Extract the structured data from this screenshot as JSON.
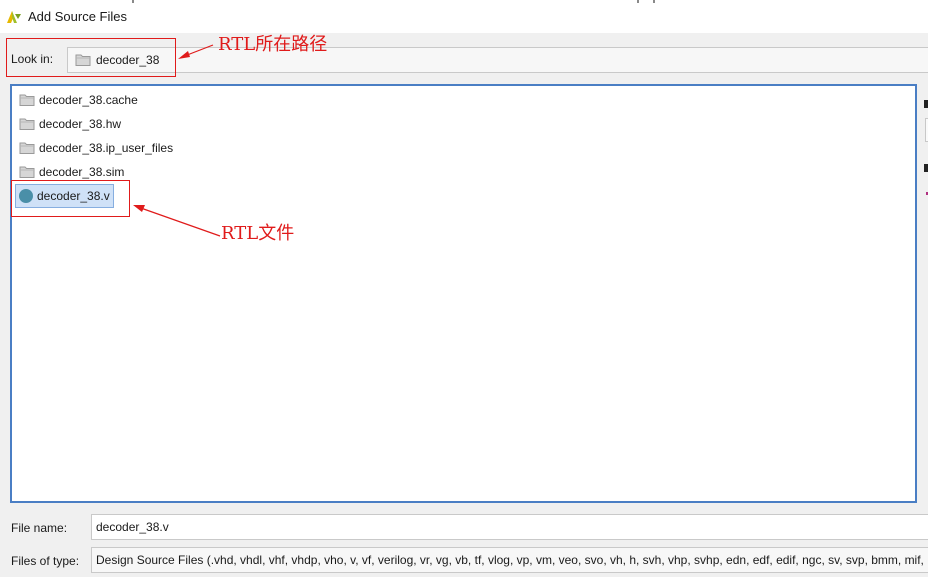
{
  "window": {
    "title": "Add Source Files"
  },
  "look_in": {
    "label": "Look in:",
    "value": "decoder_38"
  },
  "files": [
    {
      "name": "decoder_38.cache",
      "type": "folder"
    },
    {
      "name": "decoder_38.hw",
      "type": "folder"
    },
    {
      "name": "decoder_38.ip_user_files",
      "type": "folder"
    },
    {
      "name": "decoder_38.sim",
      "type": "folder"
    },
    {
      "name": "decoder_38.v",
      "type": "verilog-file",
      "selected": true
    }
  ],
  "file_name": {
    "label": "File name:",
    "value": "decoder_38.v"
  },
  "files_of_type": {
    "label": "Files of type:",
    "value": "Design Source Files (.vhd, vhdl, vhf, vhdp, vho, v, vf, verilog, vr, vg, vb, tf, vlog, vp, vm, veo, svo, vh, h, svh, vhp, svhp, edn, edf, edif, ngc, sv, svp, bmm, mif, m"
  },
  "annotations": {
    "rtl_path": "RTL所在路径",
    "rtl_file": "RTL文件"
  },
  "colors": {
    "annotation": "#e01b1b",
    "list_border": "#4a7ec4",
    "selection": "#cfe1f7",
    "verilog_dot": "#4a8fa8"
  },
  "icons": {
    "app": "vivado-logo-icon",
    "folder": "folder-icon",
    "verilog": "verilog-file-icon"
  }
}
